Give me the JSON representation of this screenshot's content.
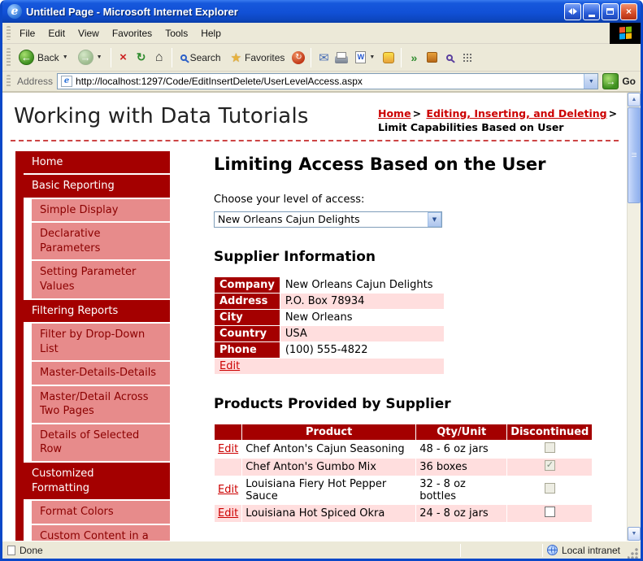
{
  "window": {
    "title": "Untitled Page - Microsoft Internet Explorer"
  },
  "menu": {
    "items": [
      "File",
      "Edit",
      "View",
      "Favorites",
      "Tools",
      "Help"
    ]
  },
  "toolbar": {
    "back_label": "Back",
    "search_label": "Search",
    "favorites_label": "Favorites"
  },
  "address": {
    "label": "Address",
    "url": "http://localhost:1297/Code/EditInsertDelete/UserLevelAccess.aspx",
    "go_label": "Go"
  },
  "icons": {
    "ie_logo": "e",
    "close": "×",
    "back_arrow": "←",
    "forward_arrow": "→",
    "dropdown": "▼",
    "stop": "×",
    "refresh": "↻",
    "home": "⌂",
    "favorites_star": "★",
    "history": "↻",
    "mail": "✉",
    "edit_doc": "W",
    "extension_arrows": "»",
    "go_arrow": "→",
    "scroll_up": "▲",
    "scroll_down": "▼"
  },
  "site": {
    "title": "Working with Data Tutorials",
    "breadcrumb": {
      "home": "Home",
      "section": "Editing, Inserting, and Deleting",
      "separator": ">",
      "current": "Limit Capabilities Based on User"
    },
    "sidebar": {
      "items": [
        {
          "label": "Home",
          "type": "section"
        },
        {
          "label": "Basic Reporting",
          "type": "section"
        },
        {
          "label": "Simple Display",
          "type": "item"
        },
        {
          "label": "Declarative Parameters",
          "type": "item"
        },
        {
          "label": "Setting Parameter Values",
          "type": "item"
        },
        {
          "label": "Filtering Reports",
          "type": "section"
        },
        {
          "label": "Filter by Drop-Down List",
          "type": "item"
        },
        {
          "label": "Master-Details-Details",
          "type": "item"
        },
        {
          "label": "Master/Detail Across Two Pages",
          "type": "item"
        },
        {
          "label": "Details of Selected Row",
          "type": "item"
        },
        {
          "label": "Customized Formatting",
          "type": "section"
        },
        {
          "label": "Format Colors",
          "type": "item"
        },
        {
          "label": "Custom Content in a",
          "type": "item"
        }
      ]
    },
    "main": {
      "heading": "Limiting Access Based on the User",
      "access_label": "Choose your level of access:",
      "access_value": "New Orleans Cajun Delights",
      "supplier": {
        "heading": "Supplier Information",
        "edit_label": "Edit",
        "rows": [
          {
            "label": "Company",
            "value": "New Orleans Cajun Delights"
          },
          {
            "label": "Address",
            "value": "P.O. Box 78934"
          },
          {
            "label": "City",
            "value": "New Orleans"
          },
          {
            "label": "Country",
            "value": "USA"
          },
          {
            "label": "Phone",
            "value": "(100) 555-4822"
          }
        ]
      },
      "products": {
        "heading": "Products Provided by Supplier",
        "columns": [
          "",
          "Product",
          "Qty/Unit",
          "Discontinued"
        ],
        "rows": [
          {
            "edit": "Edit",
            "product": "Chef Anton's Cajun Seasoning",
            "qty": "48 - 6 oz jars",
            "discontinued": false,
            "enabled": false
          },
          {
            "edit": "",
            "product": "Chef Anton's Gumbo Mix",
            "qty": "36 boxes",
            "discontinued": true,
            "enabled": false
          },
          {
            "edit": "Edit",
            "product": "Louisiana Fiery Hot Pepper Sauce",
            "qty": "32 - 8 oz bottles",
            "discontinued": false,
            "enabled": false
          },
          {
            "edit": "Edit",
            "product": "Louisiana Hot Spiced Okra",
            "qty": "24 - 8 oz jars",
            "discontinued": false,
            "enabled": true
          }
        ]
      }
    }
  },
  "status": {
    "left": "Done",
    "right": "Local intranet"
  },
  "colors": {
    "title_bar_blue": "#1658DC",
    "chrome_beige": "#ECE9D8",
    "dark_red": "#A40000",
    "sidebar_pink": "#E78B8B",
    "row_pink": "#FFDEDE",
    "link_red": "#CC0000"
  }
}
